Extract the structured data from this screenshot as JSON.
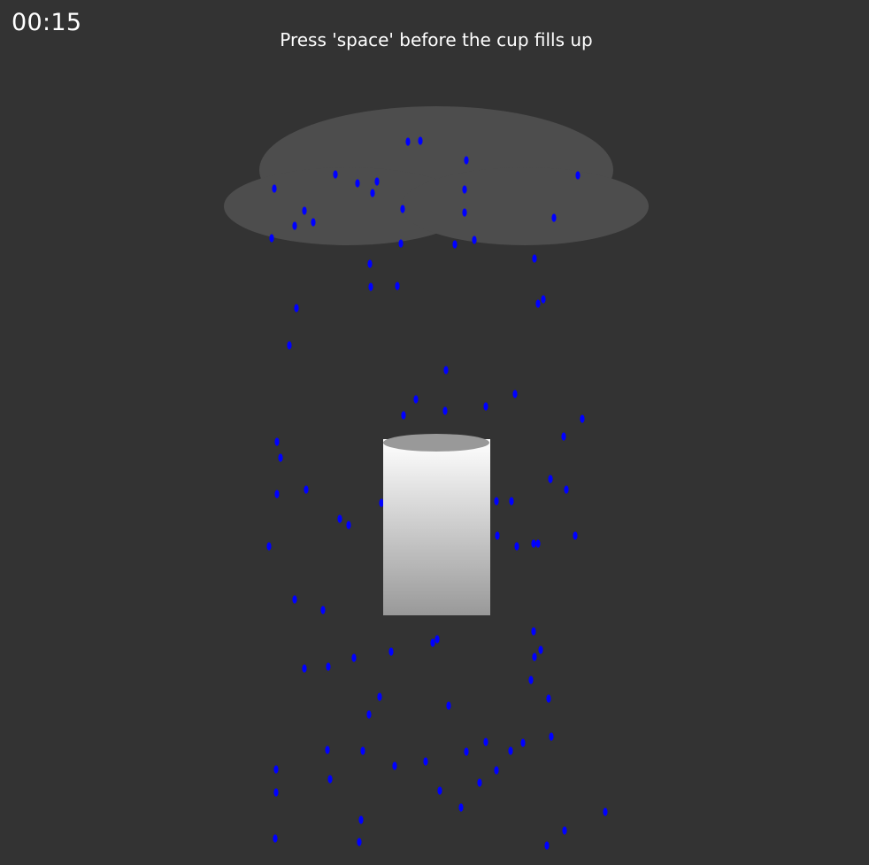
{
  "hud": {
    "timer": "00:15",
    "instruction": "Press 'space' before the cup fills up"
  },
  "colors": {
    "background": "#333333",
    "cloud": "#4d4d4d",
    "raindrop": "#0000ff",
    "cup_top": "#ffffff",
    "cup_bottom": "#999999",
    "cup_rim": "#999999",
    "text": "#ffffff"
  },
  "game": {
    "cup_fill_level": 0,
    "input_key": "space"
  }
}
